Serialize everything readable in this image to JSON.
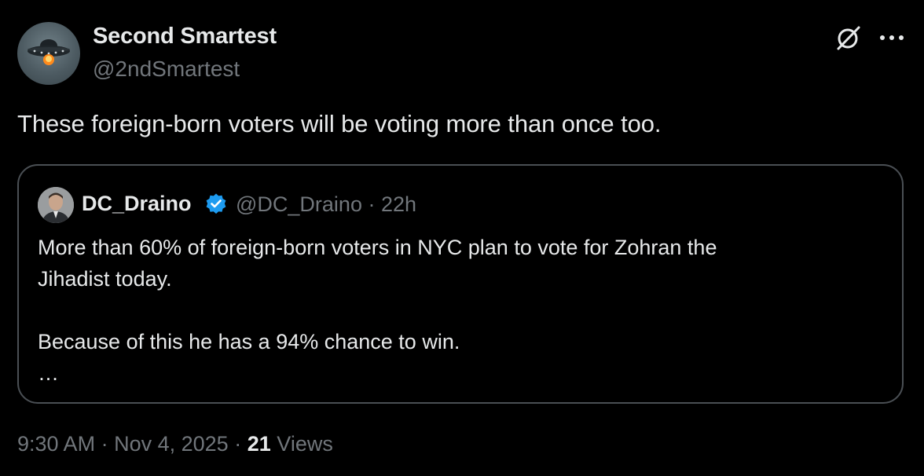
{
  "author": {
    "name": "Second Smartest",
    "handle": "@2ndSmartest",
    "avatar_icon": "ufo-avatar"
  },
  "actions": {
    "grok_icon": "grok-icon",
    "more_icon": "more-icon"
  },
  "tweet": {
    "text": "These foreign-born voters will be voting more than once too."
  },
  "quoted_tweet": {
    "name": "DC_Draino",
    "verified": true,
    "verified_color": "#1d9bf0",
    "handle": "@DC_Draino",
    "separator": "·",
    "time": "22h",
    "lines": [
      "More than 60% of foreign-born voters in NYC plan to vote for Zohran the",
      "Jihadist today.",
      "",
      "Because of this he has a 94% chance to win.",
      "…"
    ]
  },
  "footer": {
    "time": "9:30 AM",
    "separator": "·",
    "date": "Nov 4, 2025",
    "views_count": "21",
    "views_label": "Views"
  },
  "colors": {
    "background": "#000000",
    "text_primary": "#e7e9ea",
    "text_secondary": "#71767b",
    "border": "#4a4f54",
    "verified": "#1d9bf0"
  }
}
